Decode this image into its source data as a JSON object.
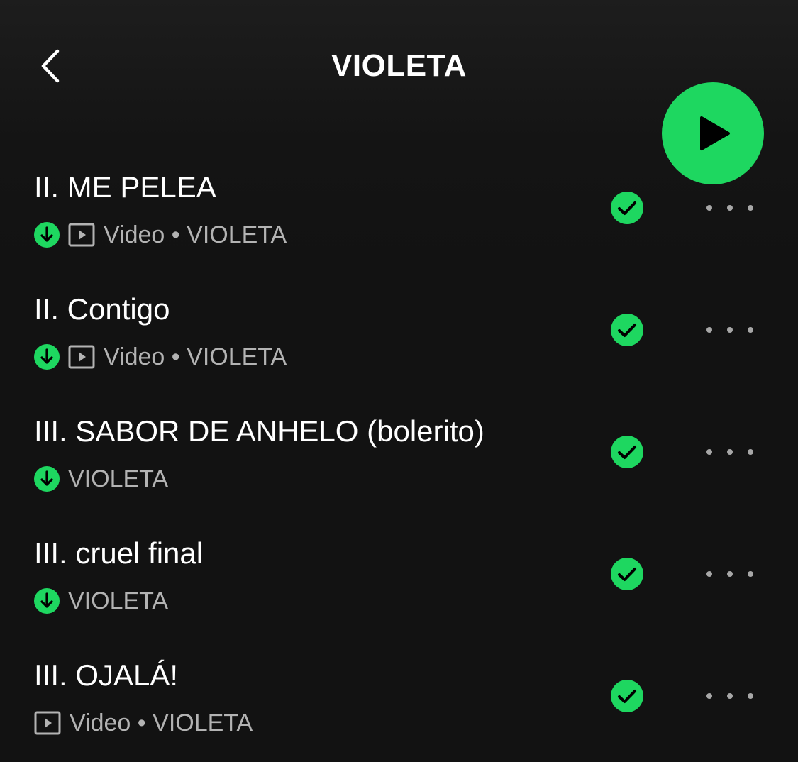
{
  "header": {
    "title": "VIOLETA"
  },
  "colors": {
    "accent": "#1ed760",
    "background": "#121212",
    "text_primary": "#ffffff",
    "text_secondary": "#b3b3b3"
  },
  "icons": {
    "back": "chevron-left-icon",
    "play": "play-icon",
    "downloaded": "download-arrow-icon",
    "video": "video-icon",
    "liked": "check-circle-icon",
    "more": "more-dots-icon"
  },
  "tracks": [
    {
      "title": "II. ME PELEA",
      "downloaded": true,
      "video": true,
      "meta": "Video • VIOLETA",
      "liked": true
    },
    {
      "title": "II. Contigo",
      "downloaded": true,
      "video": true,
      "meta": "Video • VIOLETA",
      "liked": true
    },
    {
      "title": "III. SABOR DE ANHELO (bolerito)",
      "downloaded": true,
      "video": false,
      "meta": "VIOLETA",
      "liked": true
    },
    {
      "title": "III. cruel final",
      "downloaded": true,
      "video": false,
      "meta": "VIOLETA",
      "liked": true
    },
    {
      "title": "III. OJALÁ!",
      "downloaded": false,
      "video": true,
      "meta": "Video • VIOLETA",
      "liked": true
    }
  ]
}
